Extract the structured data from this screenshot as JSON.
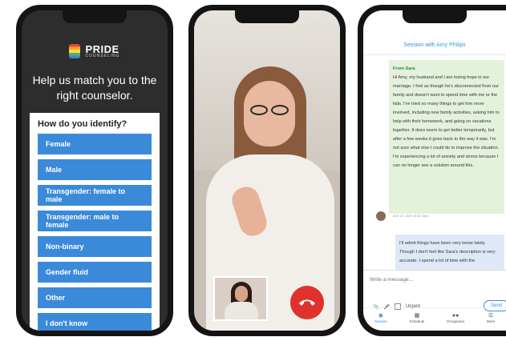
{
  "intake": {
    "brand_name": "PRIDE",
    "brand_sub": "COUNSELING",
    "headline": "Help us match you to the right counselor.",
    "question": "How do you identify?",
    "options": [
      "Female",
      "Male",
      "Transgender: female to male",
      "Transgender: male to female",
      "Non-binary",
      "Gender fluid",
      "Other",
      "I don't know"
    ]
  },
  "video_call": {
    "end_call_icon": "phone-hangup-icon",
    "accent": "#e0312c"
  },
  "chat": {
    "title_prefix": "Session with",
    "title_name": "Amy Philips",
    "incoming": {
      "from": "From Sara",
      "text": "Hi Amy, my husband and I are losing hope in our marriage. I feel as though he's disconnected from our family and doesn't want to spend time with me or the kids. I've tried so many things to get him more involved, including new family activities, asking him to help with their homework, and going on vacations together. It does seem to get better temporarily, but after a few weeks it goes back to the way it was. I'm not sure what else I could do to improve the situation. I'm experiencing a lot of anxiety and stress because I can no longer see a solution around this.",
      "timestamp": "June 15, 2020 at 02:30pm"
    },
    "outgoing": {
      "text": "I'll admit things have been very tense lately. Though I don't feel like Sara's description is very accurate. I spend a lot of time with the"
    },
    "compose_placeholder": "Write a message...",
    "urgent_label": "Urgent",
    "send_label": "Send",
    "tabs": [
      "Session",
      "Schedule",
      "Groupinars",
      "More"
    ],
    "accent": "#3b8ad9"
  }
}
